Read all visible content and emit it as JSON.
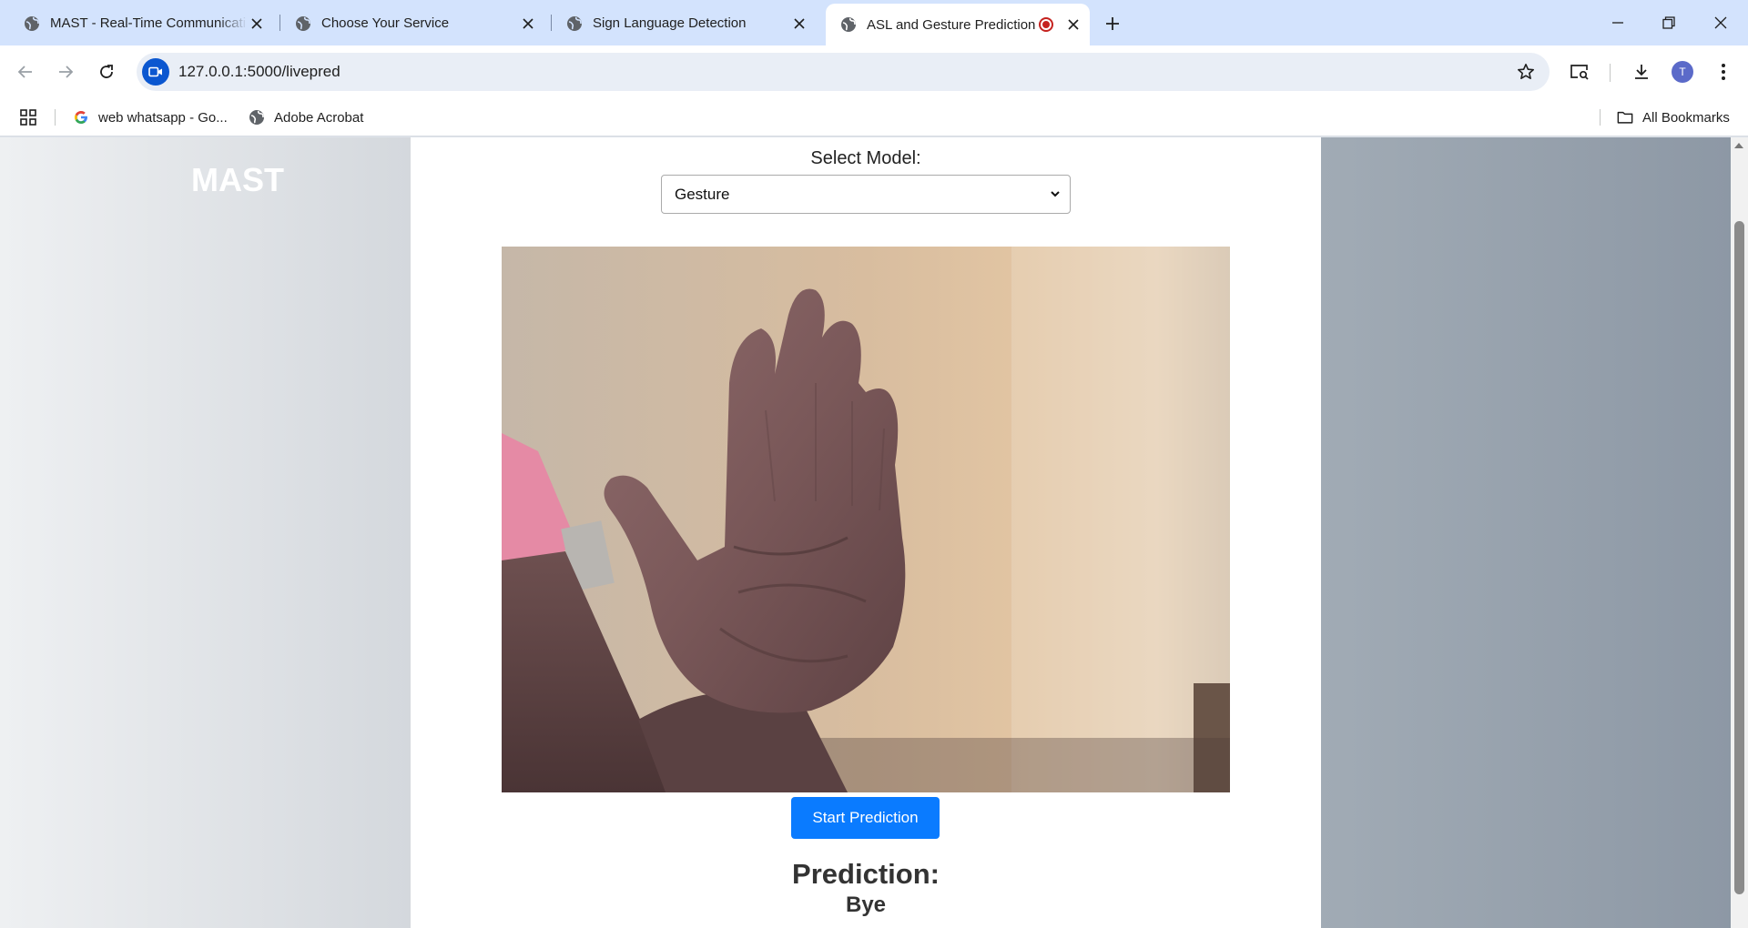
{
  "browser": {
    "tabs": [
      {
        "title": "MAST - Real-Time Communicati",
        "icon": "globe-icon",
        "active": false
      },
      {
        "title": "Choose Your Service",
        "icon": "globe-icon",
        "active": false
      },
      {
        "title": "Sign Language Detection",
        "icon": "globe-icon",
        "active": false
      },
      {
        "title": "ASL and Gesture Prediction",
        "icon": "globe-icon",
        "active": true,
        "recording": true
      }
    ],
    "url": "127.0.0.1:5000/livepred",
    "profile_initial": "T",
    "bookmarks": [
      {
        "label": "web whatsapp - Go...",
        "icon": "google-icon"
      },
      {
        "label": "Adobe Acrobat",
        "icon": "globe-icon"
      }
    ],
    "all_bookmarks_label": "All Bookmarks"
  },
  "page": {
    "logo": "MAST",
    "select_label": "Select Model:",
    "model_selected": "Gesture",
    "start_button": "Start Prediction",
    "prediction_title": "Prediction:",
    "prediction_value": "Bye"
  },
  "colors": {
    "accent_button": "#0a7bff",
    "tab_bar": "#d3e3fd",
    "right_panel": "#97a2ae"
  }
}
